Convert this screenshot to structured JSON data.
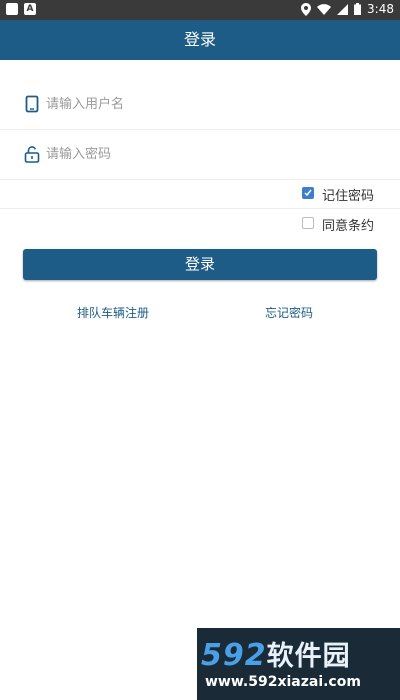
{
  "status_bar": {
    "time": "3:48",
    "left_badge": "A"
  },
  "app_bar": {
    "title": "登录"
  },
  "form": {
    "username_placeholder": "请输入用户名",
    "password_placeholder": "请输入密码",
    "remember_label": "记住密码",
    "remember_checked": true,
    "agree_label": "同意条约",
    "agree_checked": false,
    "login_label": "登录"
  },
  "links": {
    "register": "排队车辆注册",
    "forgot": "忘记密码"
  },
  "watermark": {
    "logo_num": "592",
    "logo_cn": "软件园",
    "url": "www.592xiazai.com"
  },
  "colors": {
    "primary": "#1c5c86",
    "checkbox": "#3f7ecb",
    "status_bar": "#3a3a3a"
  },
  "icons": [
    "phone-icon",
    "unlock-icon",
    "location-icon",
    "wifi-icon",
    "signal-icon",
    "battery-icon",
    "check-icon"
  ]
}
